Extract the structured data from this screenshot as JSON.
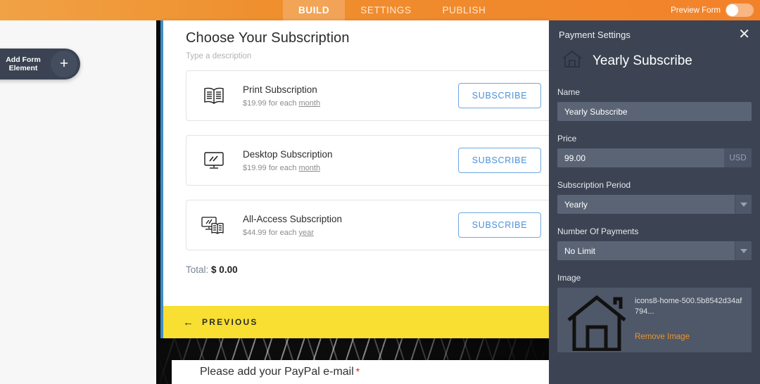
{
  "topbar": {
    "tabs": [
      {
        "label": "BUILD",
        "active": true
      },
      {
        "label": "SETTINGS",
        "active": false
      },
      {
        "label": "PUBLISH",
        "active": false
      }
    ],
    "preview_label": "Preview Form",
    "toggle_state": "off",
    "background_color": "#ef8f2e"
  },
  "sidebar": {
    "add_form_element_label": "Add Form\nElement",
    "add_form_element_line1": "Add Form",
    "add_form_element_line2": "Element",
    "plus_icon": "plus-icon"
  },
  "form": {
    "title": "Choose Your Subscription",
    "description_placeholder": "Type a description",
    "accent_color": "#3c8dc5",
    "subscriptions": [
      {
        "icon": "book-icon",
        "name": "Print Subscription",
        "price_prefix": "$19.99 for each ",
        "period": "month",
        "button_label": "SUBSCRIBE"
      },
      {
        "icon": "desktop-monitor-icon",
        "name": "Desktop Subscription",
        "price_prefix": "$19.99 for each ",
        "period": "month",
        "button_label": "SUBSCRIBE"
      },
      {
        "icon": "monitor-and-book-icon",
        "name": "All-Access Subscription",
        "price_prefix": "$44.99 for each ",
        "period": "year",
        "button_label": "SUBSCRIBE"
      }
    ],
    "total_label": "Total:",
    "total_amount": "$ 0.00",
    "previous_arrow": "←",
    "previous_label": "PREVIOUS",
    "previous_bar_color": "#f8df32"
  },
  "paypal_card": {
    "label": "Please add your PayPal e-mail",
    "required_marker": "*"
  },
  "panel": {
    "header_title": "Payment Settings",
    "close_icon": "close-icon",
    "home_icon": "home-icon",
    "item_title": "Yearly Subscribe",
    "fields": {
      "name_label": "Name",
      "name_value": "Yearly Subscribe",
      "price_label": "Price",
      "price_value": "99.00",
      "price_currency": "USD",
      "period_label": "Subscription Period",
      "period_value": "Yearly",
      "payments_label": "Number Of Payments",
      "payments_value": "No Limit",
      "image_label": "Image",
      "image_filename": "icons8-home-500.5b8542d34af794...",
      "remove_image_label": "Remove Image",
      "remove_image_color": "#e8942f"
    },
    "background_color": "#3c4453"
  }
}
